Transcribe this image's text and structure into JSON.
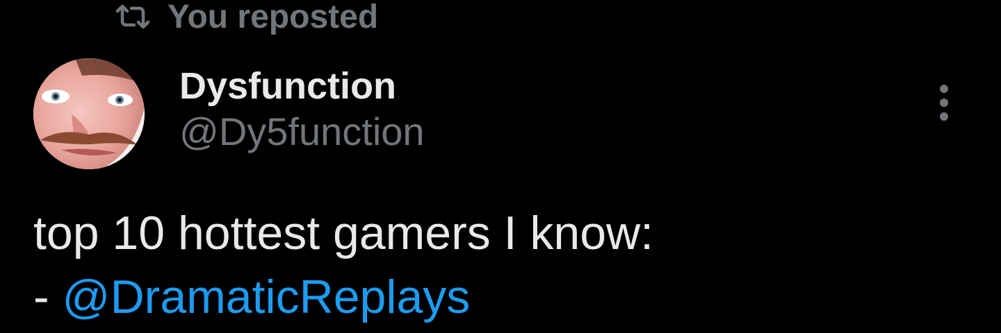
{
  "repost": {
    "icon": "repost-icon",
    "label": "You reposted"
  },
  "author": {
    "avatar": "avatar",
    "display_name": "Dysfunction",
    "handle": "@Dy5function"
  },
  "more_menu": {
    "icon": "more-vertical-icon"
  },
  "tweet": {
    "line1": "top 10 hottest gamers I know:",
    "line2_prefix": "- ",
    "mention": "@DramaticReplays"
  },
  "colors": {
    "background": "#000000",
    "primary_text": "#e7e9ea",
    "secondary_text": "#71767b",
    "link": "#1d9bf0"
  }
}
